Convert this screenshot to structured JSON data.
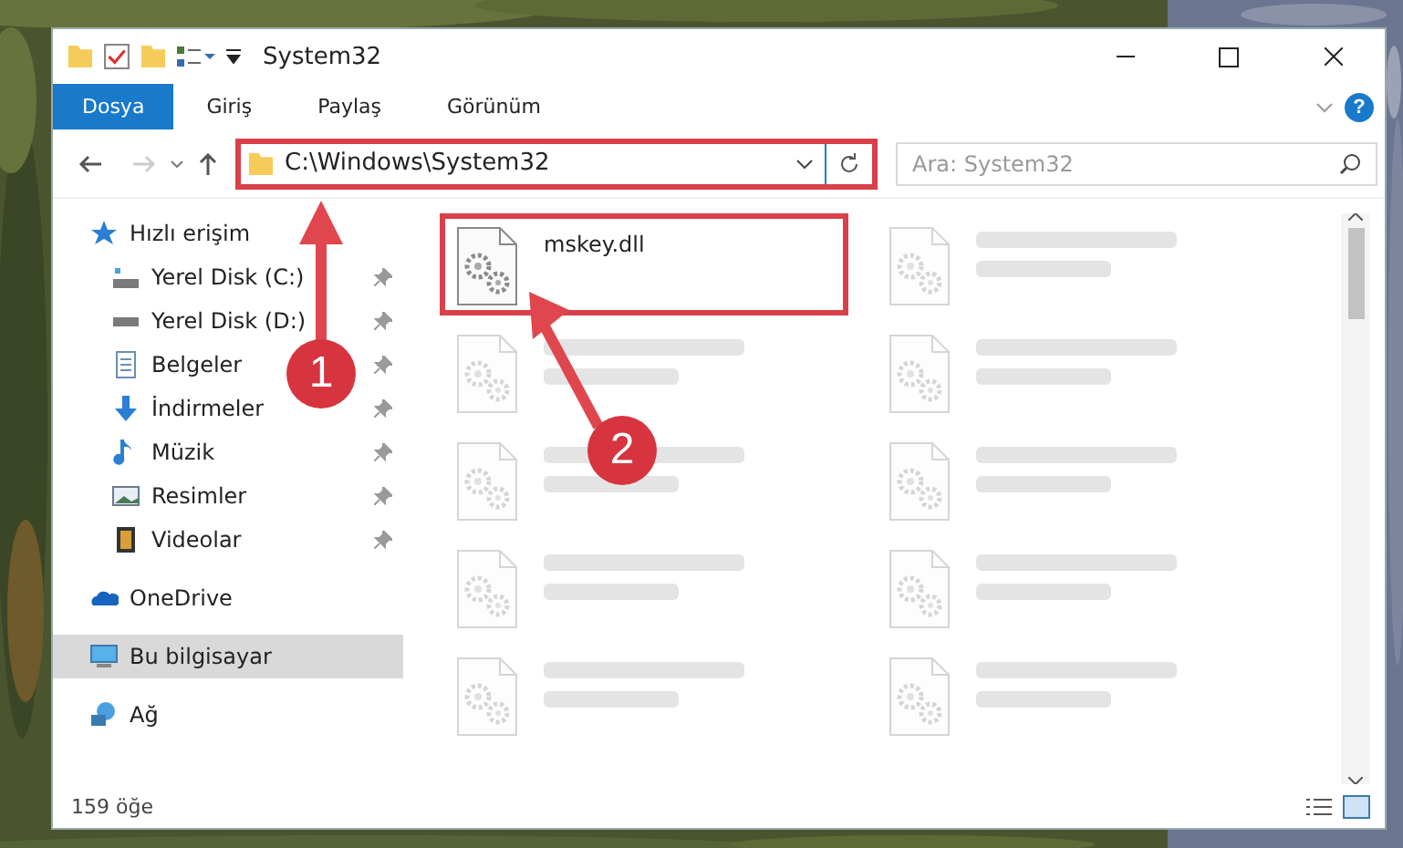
{
  "window": {
    "title": "System32"
  },
  "ribbon_tabs": [
    {
      "label": "Dosya",
      "selected": true
    },
    {
      "label": "Giriş",
      "selected": false
    },
    {
      "label": "Paylaş",
      "selected": false
    },
    {
      "label": "Görünüm",
      "selected": false
    }
  ],
  "help": "?",
  "address": {
    "path": "C:\\Windows\\System32",
    "highlighted": true
  },
  "search": {
    "placeholder": "Ara: System32"
  },
  "sidebar": {
    "items": [
      {
        "label": "Hızlı erişim",
        "pinned": false,
        "selected": false,
        "children": [
          {
            "label": "Yerel Disk (C:)",
            "pinned": true,
            "selected": false
          },
          {
            "label": "Yerel Disk (D:)",
            "pinned": true,
            "selected": false
          },
          {
            "label": "Belgeler",
            "pinned": true,
            "selected": false
          },
          {
            "label": "İndirmeler",
            "pinned": true,
            "selected": false
          },
          {
            "label": "Müzik",
            "pinned": true,
            "selected": false
          },
          {
            "label": "Resimler",
            "pinned": true,
            "selected": false
          },
          {
            "label": "Videolar",
            "pinned": true,
            "selected": false
          }
        ]
      },
      {
        "label": "OneDrive",
        "pinned": false,
        "selected": false
      },
      {
        "label": "Bu bilgisayar",
        "pinned": false,
        "selected": true
      },
      {
        "label": "Ağ",
        "pinned": false,
        "selected": false
      }
    ]
  },
  "files": [
    {
      "name": "mskey.dll",
      "blurred": false,
      "highlighted": true
    },
    {
      "blurred": true,
      "highlighted": false
    },
    {
      "blurred": true,
      "highlighted": false
    },
    {
      "blurred": true,
      "highlighted": false
    },
    {
      "blurred": true,
      "highlighted": false
    },
    {
      "blurred": true,
      "highlighted": false
    },
    {
      "blurred": true,
      "highlighted": false
    },
    {
      "blurred": true,
      "highlighted": false
    },
    {
      "blurred": true,
      "highlighted": false
    },
    {
      "blurred": true,
      "highlighted": false
    }
  ],
  "status_bar": {
    "count": "159 öğe"
  },
  "annotations": [
    {
      "label": "1"
    },
    {
      "label": "2"
    }
  ]
}
